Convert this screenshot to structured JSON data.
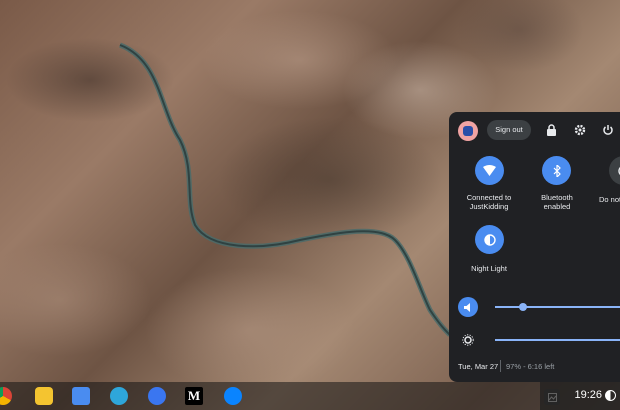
{
  "shelf": {
    "apps": [
      {
        "name": "chrome-icon",
        "color": "#e0a020"
      },
      {
        "name": "keep-icon",
        "color": "#f4c430"
      },
      {
        "name": "inbox-icon",
        "color": "#4a8cf0"
      },
      {
        "name": "telegram-icon",
        "color": "#2ea6da"
      },
      {
        "name": "signal-icon",
        "color": "#3a76f0"
      },
      {
        "name": "medium-icon",
        "color": "#000000"
      },
      {
        "name": "messenger-icon",
        "color": "#0a84ff"
      }
    ],
    "medium_letter": "M",
    "time": "19:26"
  },
  "quick_settings": {
    "sign_out_label": "Sign out",
    "features": [
      {
        "icon": "wifi-icon",
        "label": "Connected to\nJustKidding"
      },
      {
        "icon": "bluetooth-icon",
        "label": "Bluetooth\nenabled"
      },
      {
        "icon": "dnd-icon",
        "label": "Do not"
      },
      {
        "icon": "night-light-icon",
        "label": "Night Light"
      }
    ],
    "volume_level": 0.14,
    "brightness_level": 1.0,
    "date": "Tue, Mar 27",
    "battery": "97% - 6:16 left"
  },
  "colors": {
    "accent": "#4a8cf0",
    "panel_bg": "#202124",
    "slider": "#8ab4f8"
  }
}
